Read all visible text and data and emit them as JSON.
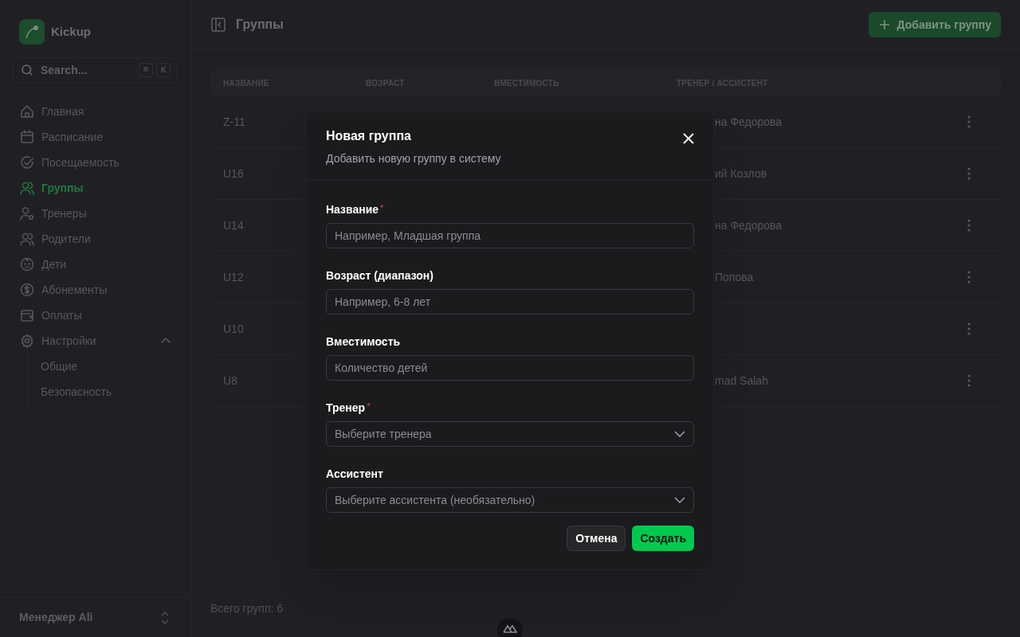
{
  "sidebar": {
    "brand": "Kickup",
    "search": {
      "label": "Search...",
      "keys": [
        "⌘",
        "K"
      ]
    },
    "nav": [
      {
        "label": "Главная",
        "selected": false
      },
      {
        "label": "Расписание",
        "selected": false
      },
      {
        "label": "Посещаемость",
        "selected": false
      },
      {
        "label": "Группы",
        "selected": true
      },
      {
        "label": "Тренеры",
        "selected": false
      },
      {
        "label": "Родители",
        "selected": false
      },
      {
        "label": "Дети",
        "selected": false
      },
      {
        "label": "Абонементы",
        "selected": false
      },
      {
        "label": "Оплаты",
        "selected": false
      },
      {
        "label": "Настройки",
        "selected": false,
        "expanded": true,
        "children": [
          {
            "label": "Общие",
            "selected": false
          },
          {
            "label": "Безопасность",
            "selected": false
          }
        ]
      }
    ],
    "user": {
      "name": "Менеджер Ali"
    }
  },
  "header": {
    "title": "Группы",
    "add_button": "Добавить группу"
  },
  "table": {
    "columns": [
      "НАЗВАНИЕ",
      "ВОЗРАСТ",
      "ВМЕСТИМОСТЬ",
      "ТРЕНЕР / АССИСТЕНТ"
    ],
    "rows": [
      {
        "name": "Z-11",
        "trainer": "на Федорова"
      },
      {
        "name": "U16",
        "trainer": "ий Козлов"
      },
      {
        "name": "U14",
        "trainer": "на Федорова"
      },
      {
        "name": "U12",
        "trainer": "Попова"
      },
      {
        "name": "U10"
      },
      {
        "name": "U8",
        "trainer": "mad Salah"
      }
    ],
    "total": "Всего групп: 6"
  },
  "dialog": {
    "title": "Новая группа",
    "subtitle": "Добавить новую группу в систему",
    "fields": [
      {
        "kind": "input",
        "label": "Название",
        "required_mark": "*",
        "placeholder": "Например, Младшая группа"
      },
      {
        "kind": "input",
        "label": "Возраст (диапазон)",
        "placeholder": "Например, 6-8 лет"
      },
      {
        "kind": "input",
        "label": "Вместимость",
        "placeholder": "Количество детей"
      },
      {
        "kind": "select",
        "label": "Тренер",
        "required_mark": "*",
        "placeholder": "Выберите тренера"
      },
      {
        "kind": "select",
        "label": "Ассистент",
        "placeholder": "Выберите ассистента (необязательно)"
      }
    ],
    "cancel": "Отмена",
    "submit": "Создать"
  }
}
